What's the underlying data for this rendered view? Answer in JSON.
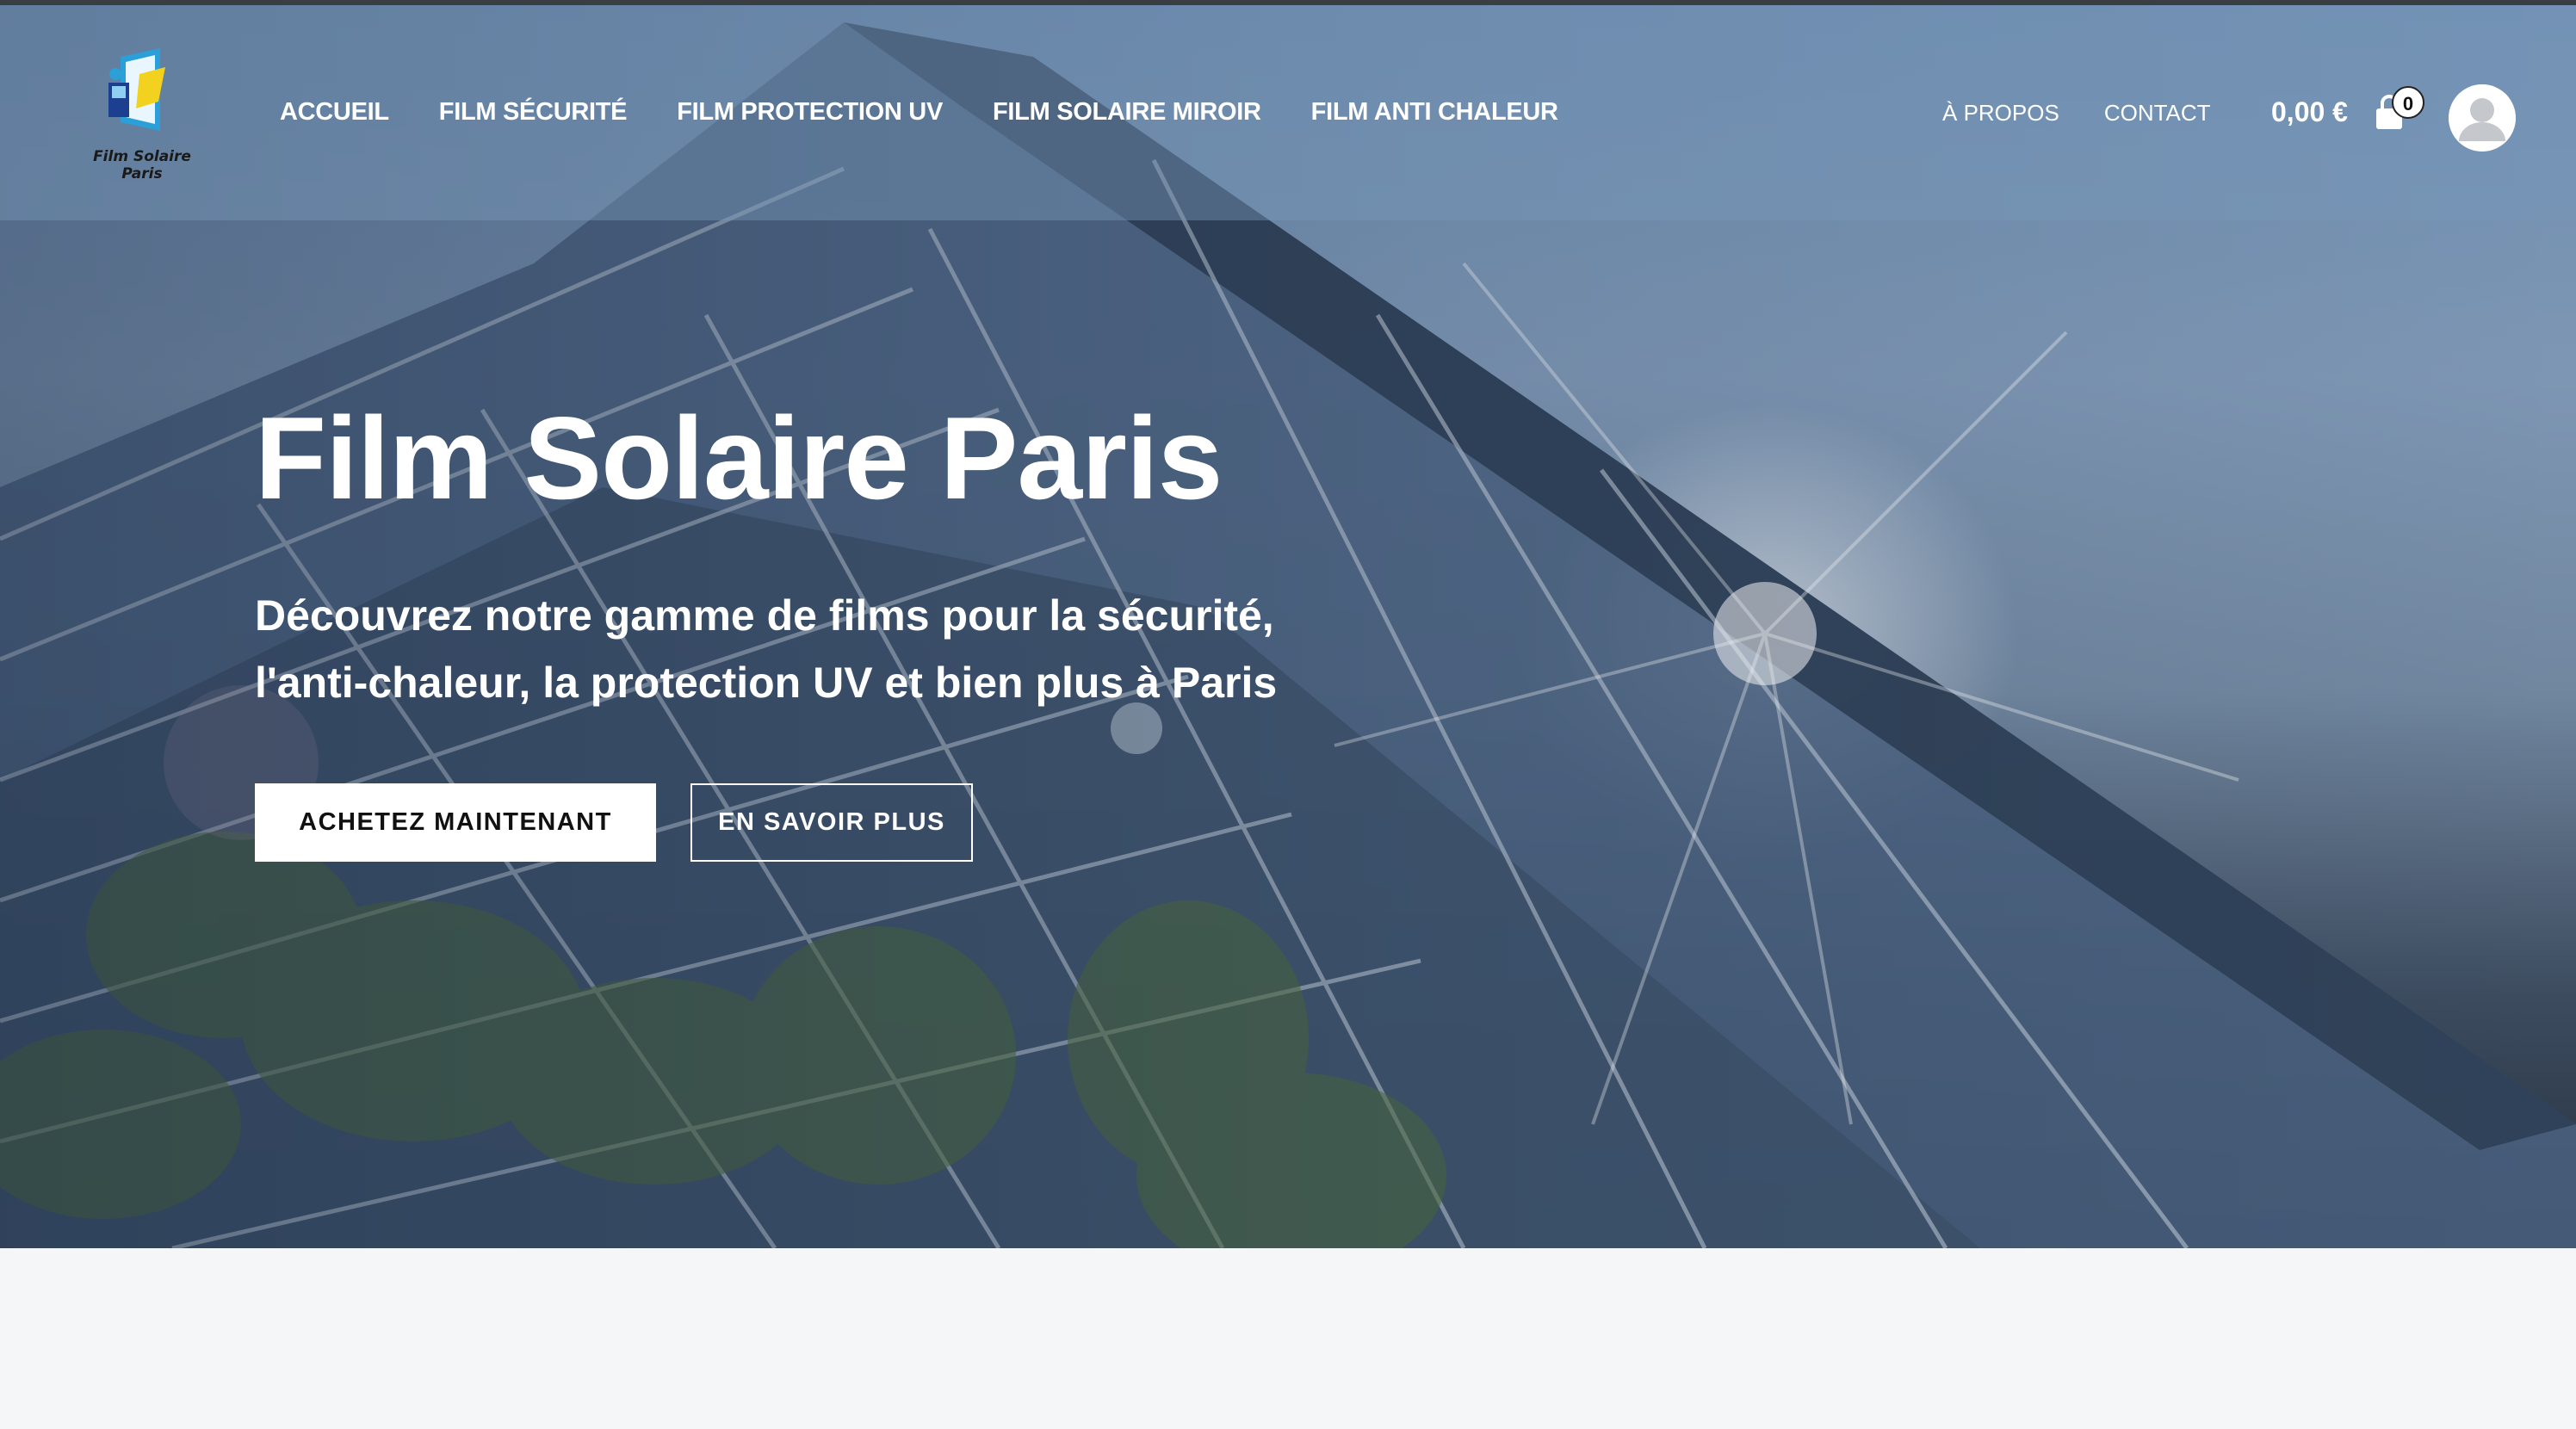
{
  "brand": {
    "logo_text": "Film Solaire Paris"
  },
  "nav": {
    "main": [
      {
        "label": "ACCUEIL"
      },
      {
        "label": "FILM SÉCURITÉ"
      },
      {
        "label": "FILM PROTECTION UV"
      },
      {
        "label": "FILM SOLAIRE MIROIR"
      },
      {
        "label": "FILM ANTI CHALEUR"
      }
    ],
    "secondary": [
      {
        "label": "À PROPOS"
      },
      {
        "label": "CONTACT"
      }
    ]
  },
  "cart": {
    "total": "0,00 €",
    "count": "0",
    "icon": "shopping-bag-icon"
  },
  "account": {
    "icon": "user-avatar-icon"
  },
  "hero": {
    "title": "Film Solaire Paris",
    "subtitle_line1": "Découvrez notre gamme de films pour la sécurité,",
    "subtitle_line2": "l'anti-chaleur, la protection UV et bien plus à Paris",
    "primary_button": "ACHETEZ MAINTENANT",
    "secondary_button": "EN SAVOIR PLUS"
  },
  "colors": {
    "header_overlay": "#7896b9",
    "button_primary_bg": "#ffffff",
    "page_background": "#f4f6f8"
  }
}
